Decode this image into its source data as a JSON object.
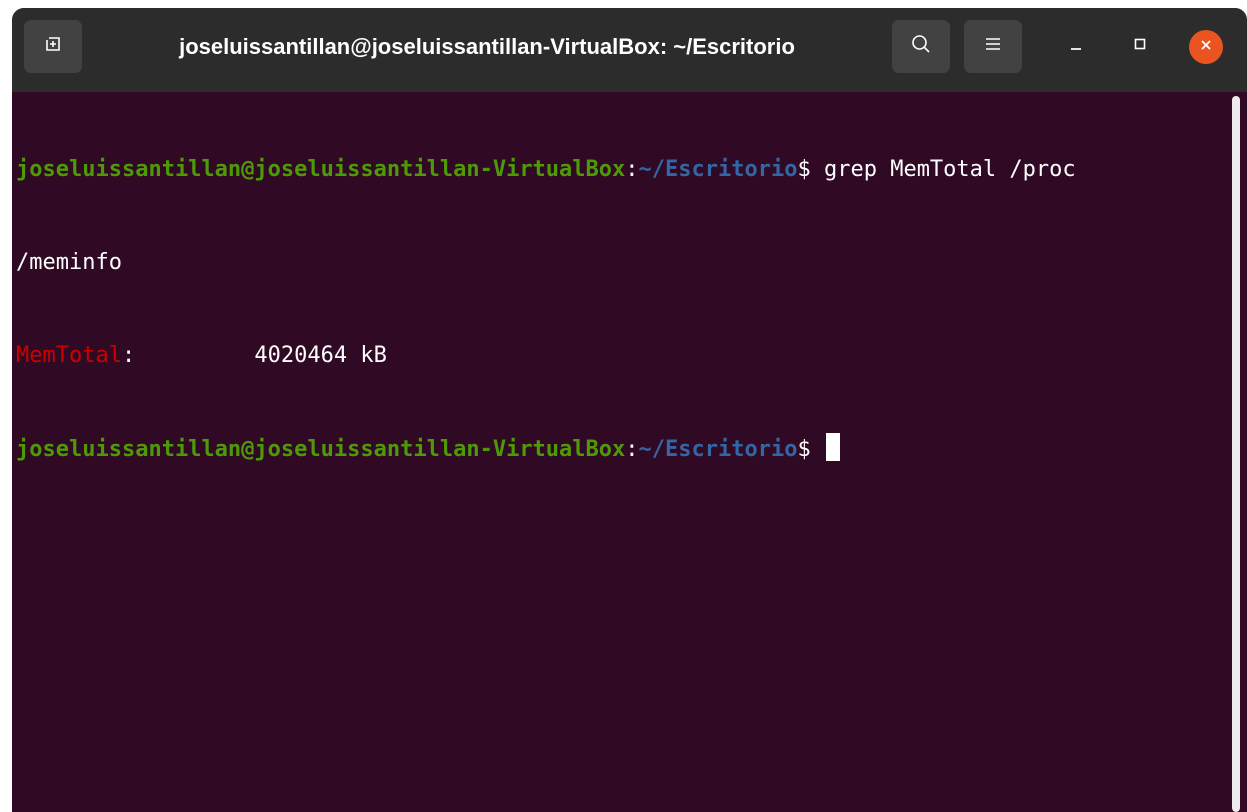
{
  "window": {
    "title": "joseluissantillan@joseluissantillan-VirtualBox: ~/Escritorio",
    "background_color": "#300a24",
    "titlebar_color": "#2c2c2c",
    "close_button_color": "#e95420"
  },
  "toolbar": {
    "new_tab_icon": "new-tab-icon",
    "search_icon": "search-icon",
    "menu_icon": "hamburger-menu-icon",
    "minimize_icon": "minimize-icon",
    "maximize_icon": "maximize-icon",
    "close_icon": "close-icon"
  },
  "terminal": {
    "colors": {
      "user_host": "#4e9a06",
      "path": "#3465a4",
      "error_key": "#cc0000",
      "text": "#ffffff"
    },
    "line1": {
      "user_host": "joseluissantillan@joseluissantillan-VirtualBox",
      "separator": ":",
      "path": "~/Escritorio",
      "command": "$ grep MemTotal /proc"
    },
    "line2": {
      "text": "/meminfo"
    },
    "line3": {
      "key": "MemTotal",
      "rest": ":         4020464 kB"
    },
    "line4": {
      "user_host": "joseluissantillan@joseluissantillan-VirtualBox",
      "separator": ":",
      "path": "~/Escritorio",
      "prompt": "$ "
    }
  }
}
